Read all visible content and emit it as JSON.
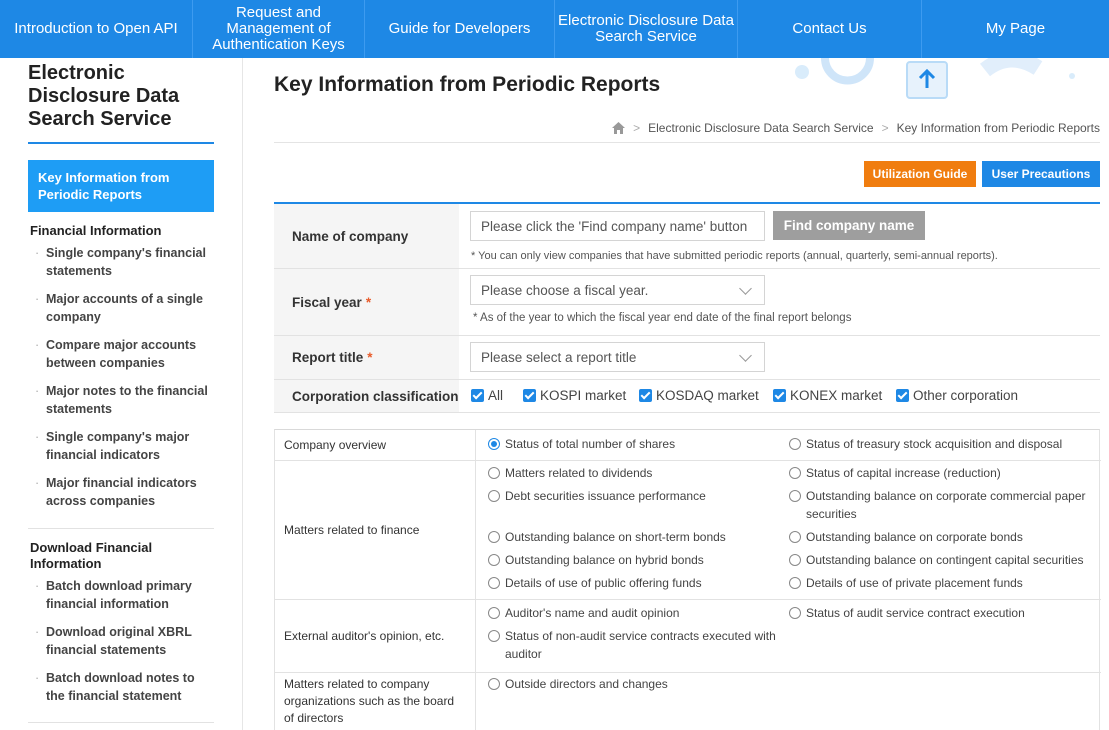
{
  "nav": {
    "items": [
      {
        "label": "Introduction to Open API"
      },
      {
        "label": "Request and Management of Authentication Keys"
      },
      {
        "label": "Guide for Developers"
      },
      {
        "label": "Electronic Disclosure Data Search Service"
      },
      {
        "label": "Contact Us"
      },
      {
        "label": "My Page"
      }
    ]
  },
  "sidebar": {
    "title": "Electronic Disclosure Data Search Service",
    "active_item": "Key Information from Periodic Reports",
    "sections": [
      {
        "label": "Financial Information",
        "items": [
          "Single company's financial statements",
          "Major accounts of a single company",
          "Compare major accounts between companies",
          "Major notes to the financial statements",
          "Single company's major financial indicators",
          "Major financial indicators across companies"
        ]
      },
      {
        "label": "Download Financial Information",
        "items": [
          "Batch download primary financial information",
          "Download original XBRL financial statements",
          "Batch download notes to the financial statement"
        ]
      }
    ]
  },
  "main": {
    "title": "Key Information from Periodic Reports",
    "breadcrumb": [
      "Electronic Disclosure Data Search Service",
      "Key Information from Periodic Reports"
    ],
    "buttons": {
      "guide": "Utilization Guide",
      "precautions": "User Precautions"
    }
  },
  "form": {
    "company": {
      "label": "Name of company",
      "placeholder": "Please click the 'Find company name' button",
      "button": "Find company name",
      "note": "* You can only view companies that have submitted periodic reports (annual, quarterly, semi-annual reports)."
    },
    "fiscal_year": {
      "label": "Fiscal year",
      "required": "*",
      "placeholder": "Please choose a fiscal year.",
      "note": "* As of the year to which the fiscal year end date of the final report belongs"
    },
    "report_title": {
      "label": "Report title",
      "required": "*",
      "placeholder": "Please select a report title"
    },
    "classification": {
      "label": "Corporation classification",
      "options": [
        "All",
        "KOSPI market",
        "KOSDAQ market",
        "KONEX market",
        "Other corporation"
      ]
    }
  },
  "report_table": {
    "rows": [
      {
        "category": "Company overview",
        "options": [
          "Status of total number of shares",
          "Status of treasury stock acquisition and disposal"
        ],
        "selected": 0
      },
      {
        "category": "Matters related to finance",
        "options": [
          "Matters related to dividends",
          "Status of capital increase (reduction)",
          "Debt securities issuance performance",
          "Outstanding balance on corporate commercial paper securities",
          "Outstanding balance on short-term bonds",
          "Outstanding balance on corporate bonds",
          "Outstanding balance on hybrid bonds",
          "Outstanding balance on contingent capital securities",
          "Details of use of public offering funds",
          "Details of use of private placement funds"
        ]
      },
      {
        "category": "External auditor's opinion, etc.",
        "options": [
          "Auditor's name and audit opinion",
          "Status of audit service contract execution",
          "Status of non-audit service contracts executed with auditor"
        ]
      },
      {
        "category": "Matters related to company organizations such as the board of directors",
        "options": [
          "Outside directors and changes"
        ]
      }
    ]
  },
  "colors": {
    "primary": "#1e88e5",
    "orange": "#f07d0f",
    "active_sidebar": "#1e9df5",
    "required": "#e85b2a"
  }
}
